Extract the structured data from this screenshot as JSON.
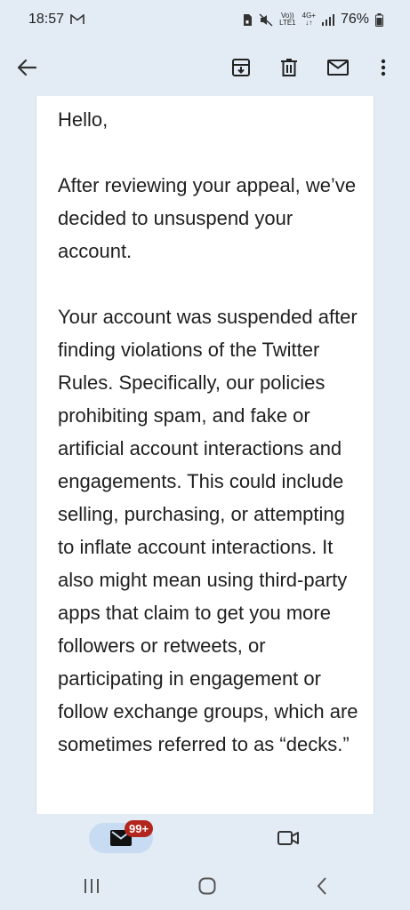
{
  "status_bar": {
    "time": "18:57",
    "network_top": "Vo))",
    "network_bottom": "LTE1",
    "data_top": "4G+",
    "data_bottom": "↓↑",
    "battery": "76%"
  },
  "app_bar": {
    "back_icon": "arrow-back-icon",
    "archive_icon": "archive-icon",
    "delete_icon": "trash-icon",
    "mark_unread_icon": "mail-icon",
    "more_icon": "more-vert-icon"
  },
  "email": {
    "paragraphs": [
      "Hello,",
      "After reviewing your appeal, we’ve decided to unsuspend your account.",
      "Your account was suspended after finding violations of the Twitter Rules. Specifically, our policies prohibiting spam, and fake or artificial account interactions and engagements. This could include selling, purchasing, or attempting to inflate account interactions. It also might mean using third-party apps that claim to get you more followers or retweets, or participating in engagement or follow exchange groups, which are sometimes referred to as “decks.”"
    ]
  },
  "bottom_nav": {
    "mail_badge": "99+",
    "mail_icon": "mail-icon",
    "meet_icon": "video-icon"
  },
  "system_nav": {
    "recents_icon": "recents-icon",
    "home_icon": "home-icon",
    "back_icon": "back-chevron-icon"
  },
  "colors": {
    "background": "#e3ecf5",
    "card": "#ffffff",
    "badge": "#b3261e",
    "pill": "#c7dcf3"
  }
}
